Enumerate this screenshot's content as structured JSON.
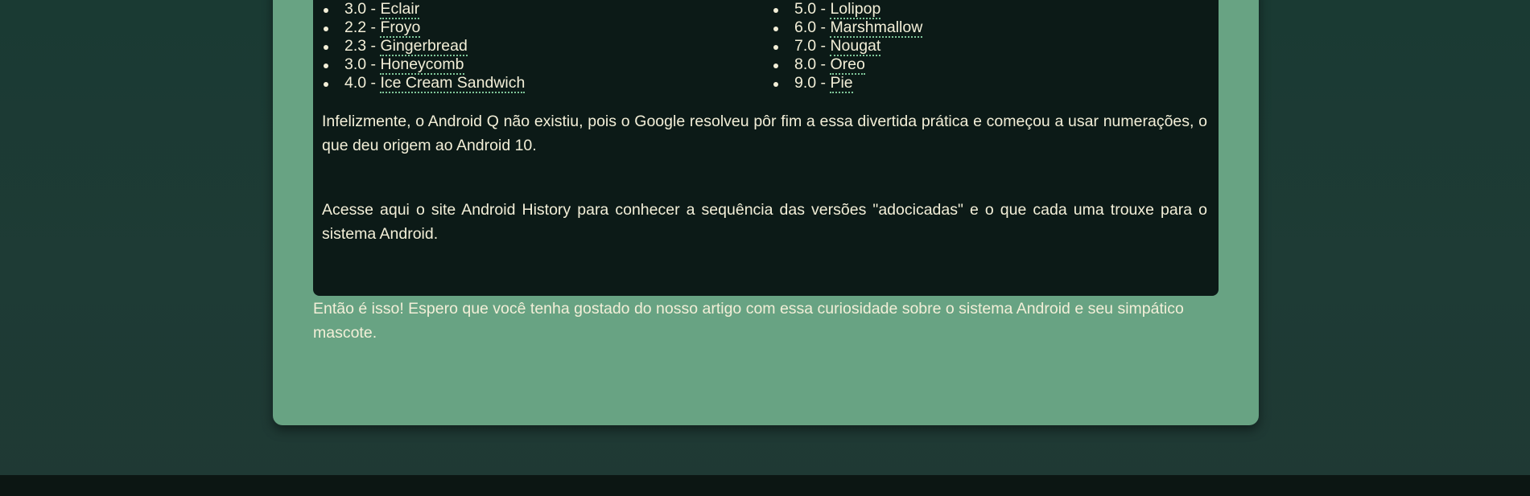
{
  "versions_left": [
    {
      "number": "3.0 - ",
      "name": "Eclair"
    },
    {
      "number": "2.2 - ",
      "name": "Froyo"
    },
    {
      "number": "2.3 - ",
      "name": "Gingerbread"
    },
    {
      "number": "3.0 - ",
      "name": "Honeycomb"
    },
    {
      "number": "4.0 - ",
      "name": "Ice Cream Sandwich"
    }
  ],
  "versions_right": [
    {
      "number": "5.0 - ",
      "name": "Lolipop"
    },
    {
      "number": "6.0 - ",
      "name": "Marshmallow"
    },
    {
      "number": "7.0 - ",
      "name": "Nougat"
    },
    {
      "number": "8.0 - ",
      "name": "Oreo"
    },
    {
      "number": "9.0 - ",
      "name": "Pie"
    }
  ],
  "paragraphs": {
    "android_q": "Infelizmente, o Android Q não existiu, pois o Google resolveu pôr fim a essa divertida prática e começou a usar numerações, o que deu origem ao Android 10.",
    "android_history": "Acesse aqui o site Android History para conhecer a sequência das versões \"adocicadas\" e o que cada uma trouxe para o sistema Android."
  },
  "outro": "Então é isso! Espero que você tenha gostado do nosso artigo com essa curiosidade sobre o sistema Android e seu simpático mascote.",
  "colors": {
    "page_background": "#1e3b35",
    "card_background": "#68a383",
    "dark_box_background": "#0c1a17",
    "text": "#f3efd8",
    "link_underline": "#7fc79a",
    "footer": "#0c1613"
  }
}
